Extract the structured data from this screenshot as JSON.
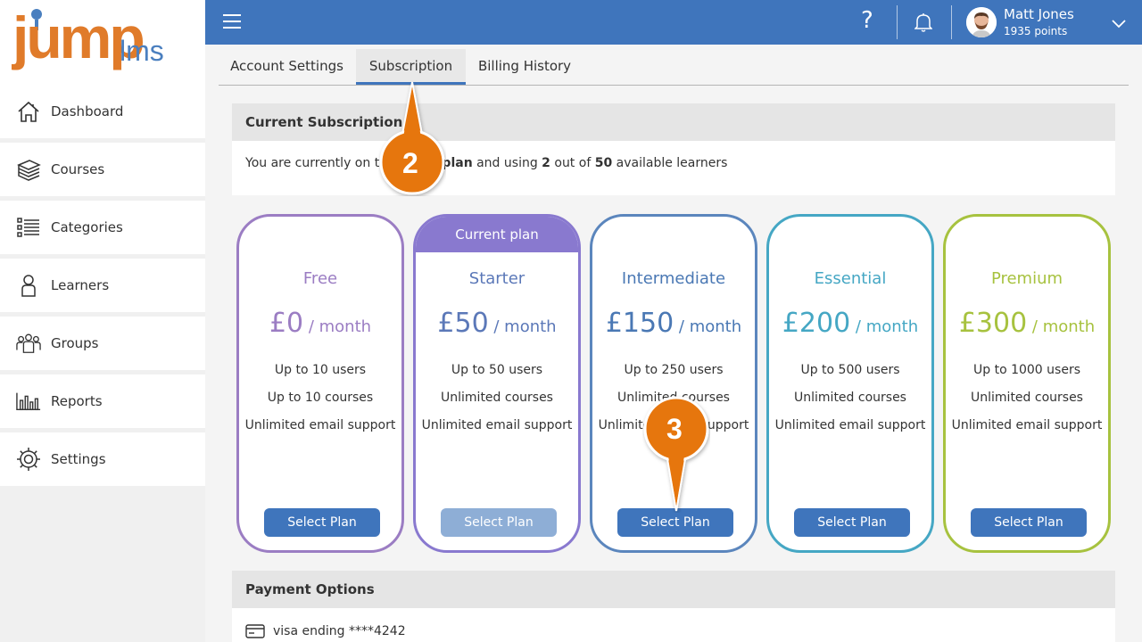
{
  "logo": {
    "primary": "jump",
    "secondary": "lms"
  },
  "sidebar": {
    "items": [
      {
        "label": "Dashboard",
        "icon": "home-icon"
      },
      {
        "label": "Courses",
        "icon": "books-icon"
      },
      {
        "label": "Categories",
        "icon": "list-icon"
      },
      {
        "label": "Learners",
        "icon": "person-icon"
      },
      {
        "label": "Groups",
        "icon": "group-icon"
      },
      {
        "label": "Reports",
        "icon": "bar-chart-icon"
      },
      {
        "label": "Settings",
        "icon": "gear-icon"
      }
    ]
  },
  "topbar": {
    "user_name": "Matt Jones",
    "user_points": "1935 points",
    "help_glyph": "?",
    "accent": "#3f75bc"
  },
  "tabs": [
    {
      "label": "Account Settings",
      "active": false
    },
    {
      "label": "Subscription",
      "active": true
    },
    {
      "label": "Billing History",
      "active": false
    }
  ],
  "current_subscription": {
    "heading": "Current Subscription",
    "text_before": "You are currently on t",
    "text_hidden_end": "y",
    "plan_name": "Starter plan",
    "text_mid": " and using ",
    "used": "2",
    "text_out_of": " out of ",
    "available": "50",
    "text_after": " available learners"
  },
  "plans": [
    {
      "name": "Free",
      "price": "£0",
      "per": " / month",
      "users": "Up to 10 users",
      "courses": "Up to 10 courses",
      "support": "Unlimited email support",
      "button": "Select Plan",
      "color": "#9b7dc3",
      "current": false
    },
    {
      "name": "Starter",
      "price": "£50",
      "per": " / month",
      "users": "Up to 50 users",
      "courses": "Unlimited courses",
      "support": "Unlimited email support",
      "button": "Select Plan",
      "color": "#8979cf",
      "current": true,
      "current_label": "Current plan"
    },
    {
      "name": "Intermediate",
      "price": "£150",
      "per": " / month",
      "users": "Up to 250 users",
      "courses": "Unlimited courses",
      "support": "Unlimited email support",
      "button": "Select Plan",
      "color": "#5b86bd",
      "current": false
    },
    {
      "name": "Essential",
      "price": "£200",
      "per": " / month",
      "users": "Up to 500 users",
      "courses": "Unlimited courses",
      "support": "Unlimited email support",
      "button": "Select Plan",
      "color": "#45a7c4",
      "current": false
    },
    {
      "name": "Premium",
      "price": "£300",
      "per": " / month",
      "users": "Up to 1000 users",
      "courses": "Unlimited courses",
      "support": "Unlimited email support",
      "button": "Select Plan",
      "color": "#a7c23f",
      "current": false
    }
  ],
  "payment": {
    "heading": "Payment Options",
    "card_text": "visa ending ****4242"
  },
  "callouts": {
    "step2": "2",
    "step3": "3",
    "color": "#e6760f"
  }
}
